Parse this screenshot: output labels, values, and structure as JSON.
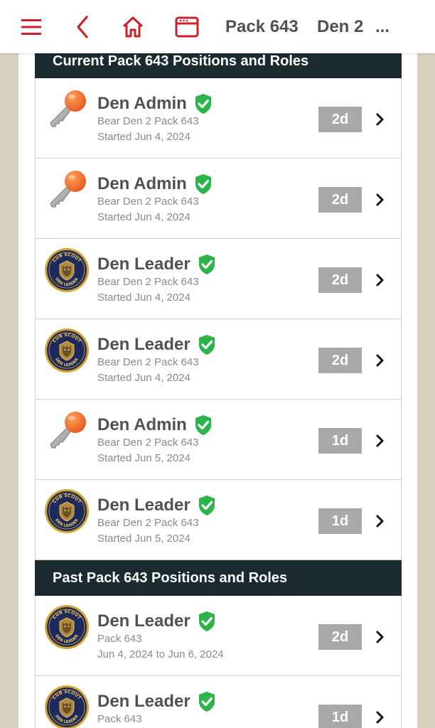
{
  "header": {
    "pack_label": "Pack 643",
    "den_label": "Den 2",
    "more_label": "...",
    "accent_color": "#cc2029"
  },
  "sections": {
    "current_title": "Current Pack 643 Positions and Roles",
    "past_title": "Past Pack 643 Positions and Roles"
  },
  "current_roles": [
    {
      "title": "Den Admin",
      "icon": "key-icon",
      "unit": "Bear Den 2 Pack 643",
      "dates": "Started Jun 4, 2024",
      "badge": "2d"
    },
    {
      "title": "Den Admin",
      "icon": "key-icon",
      "unit": "Bear Den 2 Pack 643",
      "dates": "Started Jun 4, 2024",
      "badge": "2d"
    },
    {
      "title": "Den Leader",
      "icon": "cub-scout-den-leader-patch-icon",
      "unit": "Bear Den 2 Pack 643",
      "dates": "Started Jun 4, 2024",
      "badge": "2d"
    },
    {
      "title": "Den Leader",
      "icon": "cub-scout-den-leader-patch-icon",
      "unit": "Bear Den 2 Pack 643",
      "dates": "Started Jun 4, 2024",
      "badge": "2d"
    },
    {
      "title": "Den Admin",
      "icon": "key-icon",
      "unit": "Bear Den 2 Pack 643",
      "dates": "Started Jun 5, 2024",
      "badge": "1d"
    },
    {
      "title": "Den Leader",
      "icon": "cub-scout-den-leader-patch-icon",
      "unit": "Bear Den 2 Pack 643",
      "dates": "Started Jun 5, 2024",
      "badge": "1d"
    }
  ],
  "past_roles": [
    {
      "title": "Den Leader",
      "icon": "cub-scout-den-leader-patch-icon",
      "unit": "Pack 643",
      "dates": "Jun 4, 2024 to Jun 6, 2024",
      "badge": "2d"
    },
    {
      "title": "Den Leader",
      "icon": "cub-scout-den-leader-patch-icon",
      "unit": "Pack 643",
      "dates": "",
      "badge": "1d"
    }
  ],
  "patch_text": {
    "top": "CUB SCOUT",
    "bottom": "DEN LEADER"
  }
}
